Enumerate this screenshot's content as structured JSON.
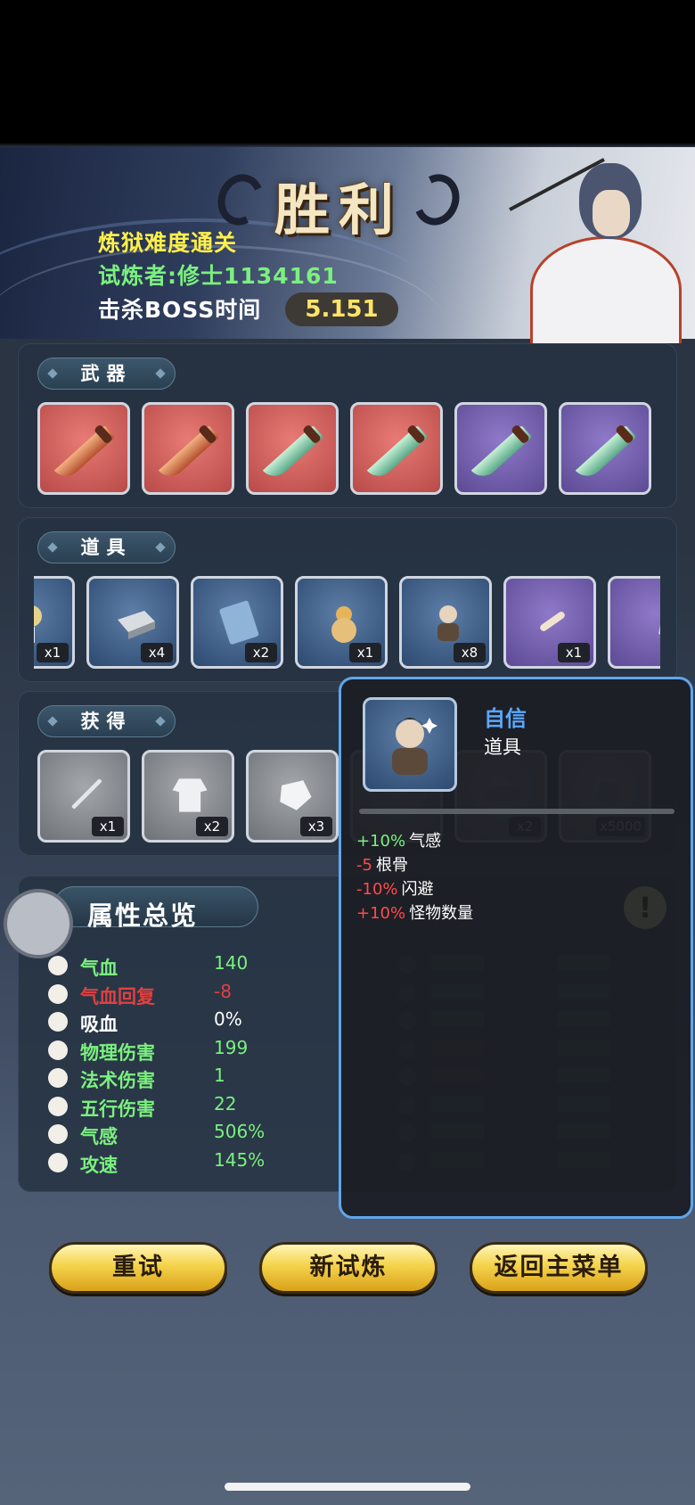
{
  "banner": {
    "victory": "胜利",
    "difficulty": "炼狱难度通关",
    "challenger": "试炼者:修士1134161",
    "boss_time_label": "击杀BOSS时间",
    "boss_time_value": "5.151"
  },
  "weapons": {
    "tab": "武器",
    "slots": [
      {
        "rarity": "red",
        "icon": "bronze-saber-icon"
      },
      {
        "rarity": "red",
        "icon": "bronze-saber-icon"
      },
      {
        "rarity": "red",
        "icon": "jade-saber-icon"
      },
      {
        "rarity": "red",
        "icon": "jade-saber-icon"
      },
      {
        "rarity": "purple",
        "icon": "jade-saber-icon"
      },
      {
        "rarity": "purple",
        "icon": "jade-saber-icon"
      }
    ]
  },
  "items": {
    "tab": "道具",
    "slots": [
      {
        "icon": "amulet-icon",
        "count": "x1",
        "rarity": "blue"
      },
      {
        "icon": "stone-block-icon",
        "count": "x4",
        "rarity": "blue"
      },
      {
        "icon": "book-icon",
        "count": "x2",
        "rarity": "blue"
      },
      {
        "icon": "gourd-icon",
        "count": "x1",
        "rarity": "blue"
      },
      {
        "icon": "confident-cultivator-icon",
        "count": "x8",
        "rarity": "blue"
      },
      {
        "icon": "bone-icon",
        "count": "x1",
        "rarity": "purple"
      },
      {
        "icon": "crystal-icon",
        "count": "",
        "rarity": "purple"
      }
    ]
  },
  "gains": {
    "tab": "获得",
    "slots": [
      {
        "icon": "sword-icon",
        "count": "x1"
      },
      {
        "icon": "robe-icon",
        "count": "x2"
      },
      {
        "icon": "ore-icon",
        "count": "x3"
      },
      {
        "icon": "hidden-item-icon",
        "count": ""
      },
      {
        "icon": "belt-icon",
        "count": "x2"
      },
      {
        "icon": "gem-icon",
        "count": "x5000"
      }
    ]
  },
  "tooltip": {
    "name": "自信",
    "type": "道具",
    "icon": "confident-cultivator-icon",
    "effects": [
      {
        "value": "+10%",
        "label": "气感",
        "color": "#7bf07f"
      },
      {
        "value": "-5",
        "label": "根骨",
        "color": "#ff4b4b"
      },
      {
        "value": "-10%",
        "label": "闪避",
        "color": "#ff4b4b"
      },
      {
        "value": "+10%",
        "label": "怪物数量",
        "color": "#ff4b4b"
      }
    ]
  },
  "attributes": {
    "title": "属性总览",
    "rows": [
      {
        "icon": "heart-icon",
        "label": "气血",
        "value": "140",
        "label_color": "#7bf07f",
        "value_color": "#7bf07f"
      },
      {
        "icon": "broken-heart-icon",
        "label": "气血回复",
        "value": "-8",
        "label_color": "#e04040",
        "value_color": "#e04040"
      },
      {
        "icon": "blood-drop-icon",
        "label": "吸血",
        "value": "0%",
        "label_color": "#ffffff",
        "value_color": "#ffffff"
      },
      {
        "icon": "physical-damage-icon",
        "label": "物理伤害",
        "value": "199",
        "label_color": "#7bf07f",
        "value_color": "#7bf07f"
      },
      {
        "icon": "spell-swirl-icon",
        "label": "法术伤害",
        "value": "1",
        "label_color": "#7bf07f",
        "value_color": "#7bf07f"
      },
      {
        "icon": "five-elements-icon",
        "label": "五行伤害",
        "value": "22",
        "label_color": "#7bf07f",
        "value_color": "#7bf07f"
      },
      {
        "icon": "qi-sense-icon",
        "label": "气感",
        "value": "506%",
        "label_color": "#7bf07f",
        "value_color": "#7bf07f"
      },
      {
        "icon": "attack-speed-icon",
        "label": "攻速",
        "value": "145%",
        "label_color": "#7bf07f",
        "value_color": "#7bf07f"
      }
    ],
    "right_rows": [
      {
        "icon": "crit-icon",
        "label_color": "#7bf07f"
      },
      {
        "icon": "hammer-icon",
        "label_color": "#7bf07f"
      },
      {
        "icon": "target-icon",
        "label_color": "#7bf07f"
      },
      {
        "icon": "body-icon",
        "label_color": "#e04040"
      },
      {
        "icon": "dodge-icon",
        "label_color": "#e04040"
      },
      {
        "icon": "boot-icon",
        "label_color": "#7bf07f"
      },
      {
        "icon": "cycle-icon",
        "label_color": "#7bf07f"
      },
      {
        "icon": "luck-icon",
        "label_color": "#7bf07f"
      }
    ]
  },
  "buttons": {
    "retry": "重试",
    "new_trial": "新试炼",
    "main_menu": "返回主菜单"
  },
  "colors": {
    "accent_gold": "#f4d34a",
    "tooltip_border": "#5fa6ea",
    "positive": "#7bf07f",
    "negative": "#ff4b4b"
  }
}
